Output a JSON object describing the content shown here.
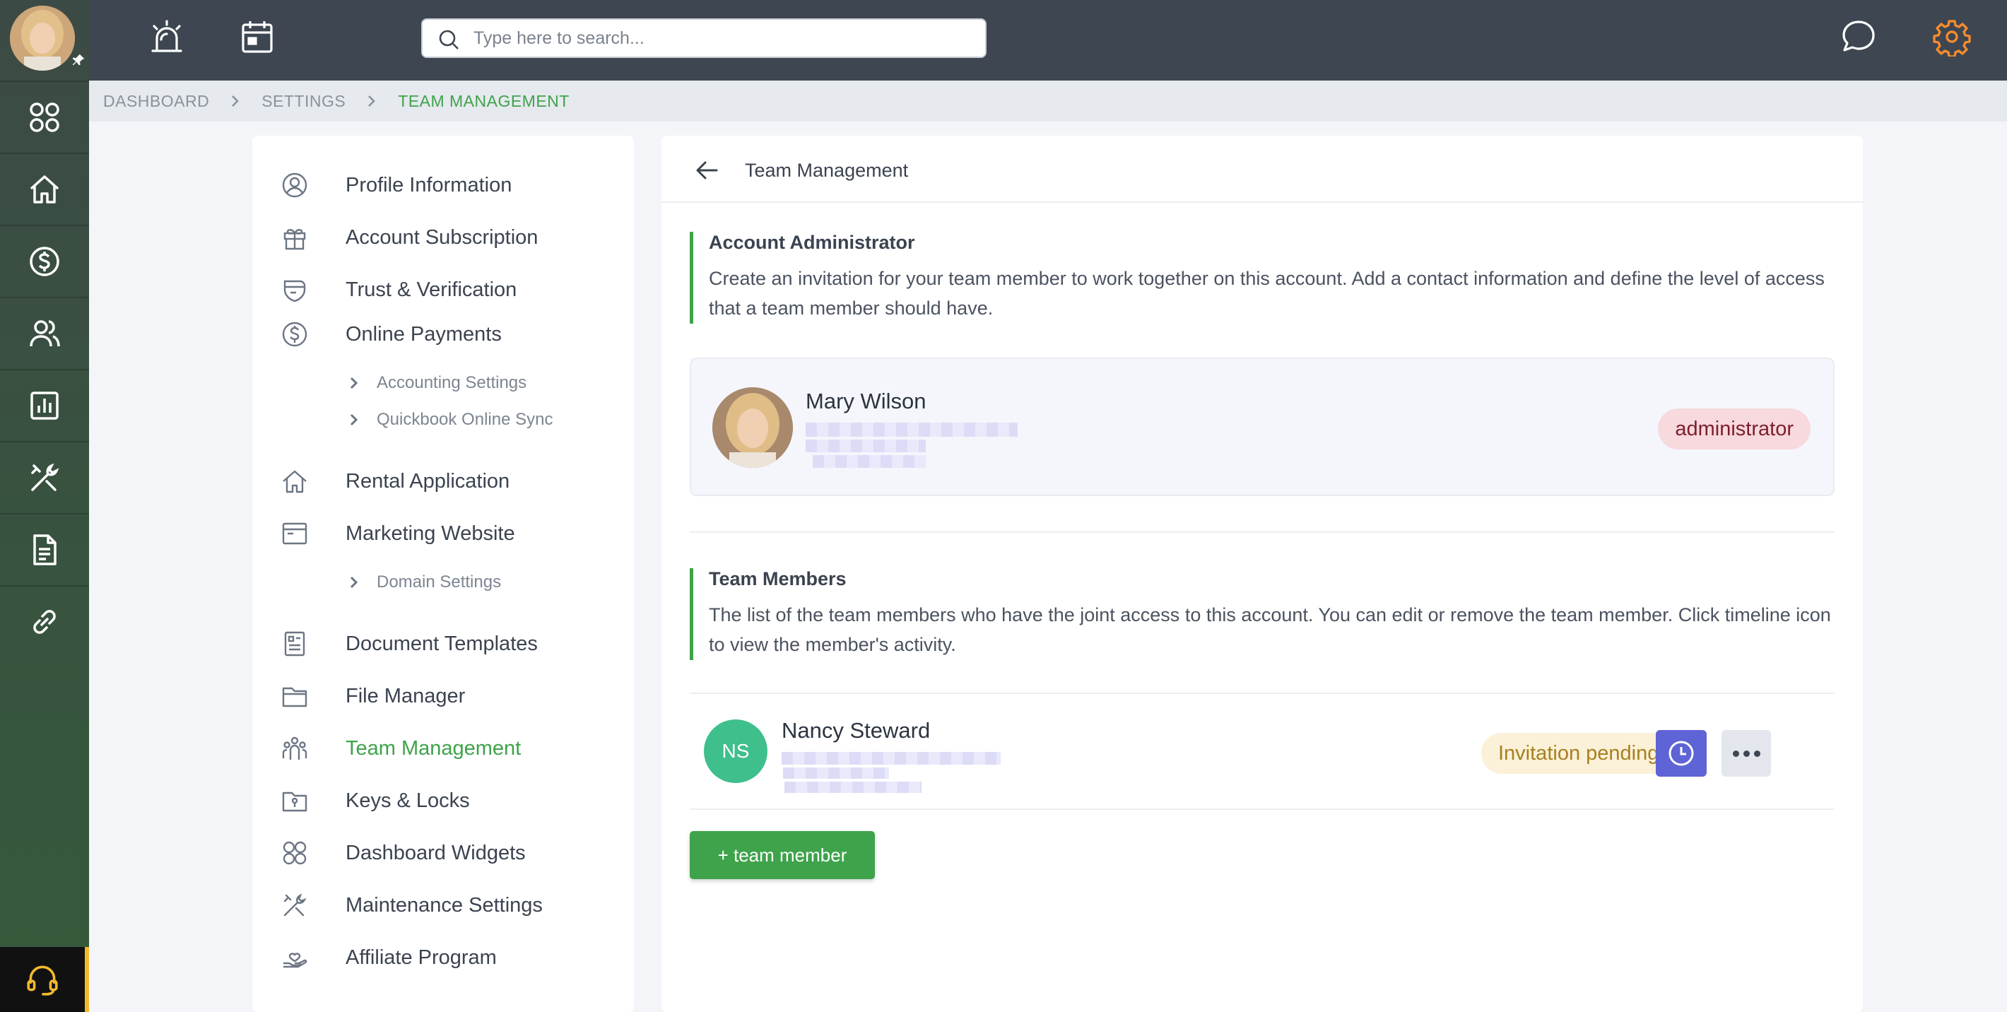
{
  "topbar": {
    "search_placeholder": "Type here to search..."
  },
  "breadcrumb": [
    "DASHBOARD",
    "SETTINGS",
    "TEAM MANAGEMENT"
  ],
  "settings_nav": {
    "profile": "Profile Information",
    "subscription": "Account Subscription",
    "trust": "Trust & Verification",
    "payments": "Online Payments",
    "accounting": "Accounting Settings",
    "quickbook": "Quickbook Online Sync",
    "rental": "Rental Application",
    "marketing": "Marketing Website",
    "domain": "Domain Settings",
    "templates": "Document Templates",
    "files": "File Manager",
    "team": "Team Management",
    "keys": "Keys & Locks",
    "widgets": "Dashboard Widgets",
    "maintenance": "Maintenance Settings",
    "affiliate": "Affiliate Program"
  },
  "main": {
    "title": "Team Management",
    "admin_section": {
      "heading": "Account Administrator",
      "description": "Create an invitation for your team member to work together on this account. Add a contact information and define the level of access that a team member should have."
    },
    "admin": {
      "name": "Mary Wilson",
      "role": "administrator"
    },
    "members_section": {
      "heading": "Team Members",
      "description": "The list of the team members who have the joint access to this account. You can edit or remove the team member. Click timeline icon to view the member's activity."
    },
    "member": {
      "initials": "NS",
      "name": "Nancy Steward",
      "status": "Invitation pending"
    },
    "add_button": "+ team member"
  },
  "colors": {
    "accent_green": "#3ea34a",
    "topbar": "#3d4651",
    "gear_orange": "#f28b2f",
    "admin_badge_bg": "#f7d9de",
    "pending_badge_bg": "#fbf1d8",
    "timeline_button": "#5e63d6"
  }
}
